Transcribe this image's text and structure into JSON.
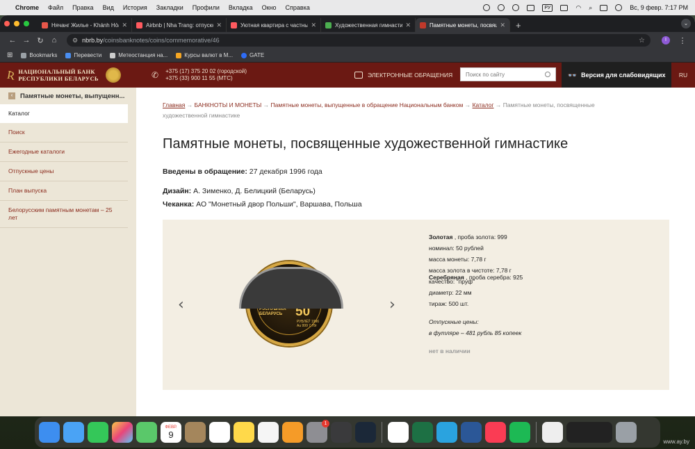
{
  "menubar": {
    "app": "Chrome",
    "items": [
      "Файл",
      "Правка",
      "Вид",
      "История",
      "Закладки",
      "Профили",
      "Вкладка",
      "Окно",
      "Справка"
    ],
    "input_source": "РУ",
    "datetime": "Вс, 9 февр.  7:17 PM"
  },
  "tabs": [
    {
      "title": "Нячанг Жилье - Khánh Hòa,",
      "color": "#e8574a"
    },
    {
      "title": "Airbnb | Nha Trang: отпускные",
      "color": "#ff5a5f"
    },
    {
      "title": "Уютная квартира с частными",
      "color": "#ff5a5f"
    },
    {
      "title": "Художественная гимнастика",
      "color": "#4caf50"
    },
    {
      "title": "Памятные монеты, посвящен",
      "color": "#c0392b"
    }
  ],
  "address": {
    "host": "nbrb.by",
    "path": "/coinsbanknotes/coins/commemorative/46"
  },
  "profile_initial": "I",
  "bookmarks": [
    {
      "label": "Bookmarks",
      "color": "#9aa0a6"
    },
    {
      "label": "Перевести",
      "color": "#4a8ef0"
    },
    {
      "label": "Метеостанция на...",
      "color": "#cccccc"
    },
    {
      "label": "Курсы валют в М...",
      "color": "#f5a623"
    },
    {
      "label": "GATE",
      "color": "#2e6cf6"
    }
  ],
  "site": {
    "logo_line1": "НАЦИОНАЛЬНЫЙ БАНК",
    "logo_line2": "РЕСПУБЛИКИ БЕЛАРУСЬ",
    "phone1": "+375 (17) 375 20 02 (городской)",
    "phone2": "+375 (33) 900 11 55 (МТС)",
    "e_appeals": "ЭЛЕКТРОННЫЕ ОБРАЩЕНИЯ",
    "search_placeholder": "Поиск по сайту",
    "accessibility": "Версия для слабовидящих",
    "lang": "RU"
  },
  "sidebar": {
    "title": "Памятные монеты, выпущенные в обращение",
    "title_short": "Памятные монеты, выпущенн...",
    "items": [
      {
        "label": "Каталог",
        "active": true
      },
      {
        "label": "Поиск"
      },
      {
        "label": "Ежегодные каталоги"
      },
      {
        "label": "Отпускные цены"
      },
      {
        "label": "План выпуска"
      },
      {
        "label": "Белорусским памятным монетам – 25 лет"
      }
    ]
  },
  "breadcrumbs": {
    "home": "Главная",
    "b1": "БАНКНОТЫ И МОНЕТЫ",
    "b2": "Памятные монеты, выпущенные в обращение Национальным банком",
    "b3": "Каталог",
    "current": "Памятные монеты, посвященные художественной гимнастике",
    "sep": "→"
  },
  "page": {
    "title": "Памятные монеты, посвященные художественной гимнастике",
    "issued_label": "Введены в обращение:",
    "issued_value": "27 декабря 1996 года",
    "design_label": "Дизайн:",
    "design_value": "А. Зименко, Д. Белицкий (Беларусь)",
    "mint_label": "Чеканка:",
    "mint_value": "АО \"Монетный двор Польши\", Варшава, Польша"
  },
  "coin_gold": {
    "metal": "Золотая",
    "fineness": ", проба золота: 999",
    "nominal": "номинал: 50 рублей",
    "mass": "масса монеты: 7,78 г",
    "pure_mass": "масса золота в чистоте: 7,78 г",
    "quality": "качество: \"пруф\"",
    "diameter": "диаметр: 22 мм",
    "mintage": "тираж: 500 шт.",
    "prices_label": "Отпускные цены:",
    "price": "в футляре – 481 рубль 85 копеек",
    "availability": "нет в наличии",
    "coin_text_left": "РЭСПУБЛІКА БЕЛАРУСЬ",
    "coin_denomination": "50",
    "coin_text_right": "РУБЛЁЎ 1996 Au 999 7,78г"
  },
  "coin_silver": {
    "metal": "Серебряная",
    "fineness": ", проба серебра: 925"
  },
  "dock": {
    "calendar_month": "ФЕВР.",
    "calendar_day": "9",
    "badge": "1"
  },
  "watermark": "www.ay.by"
}
